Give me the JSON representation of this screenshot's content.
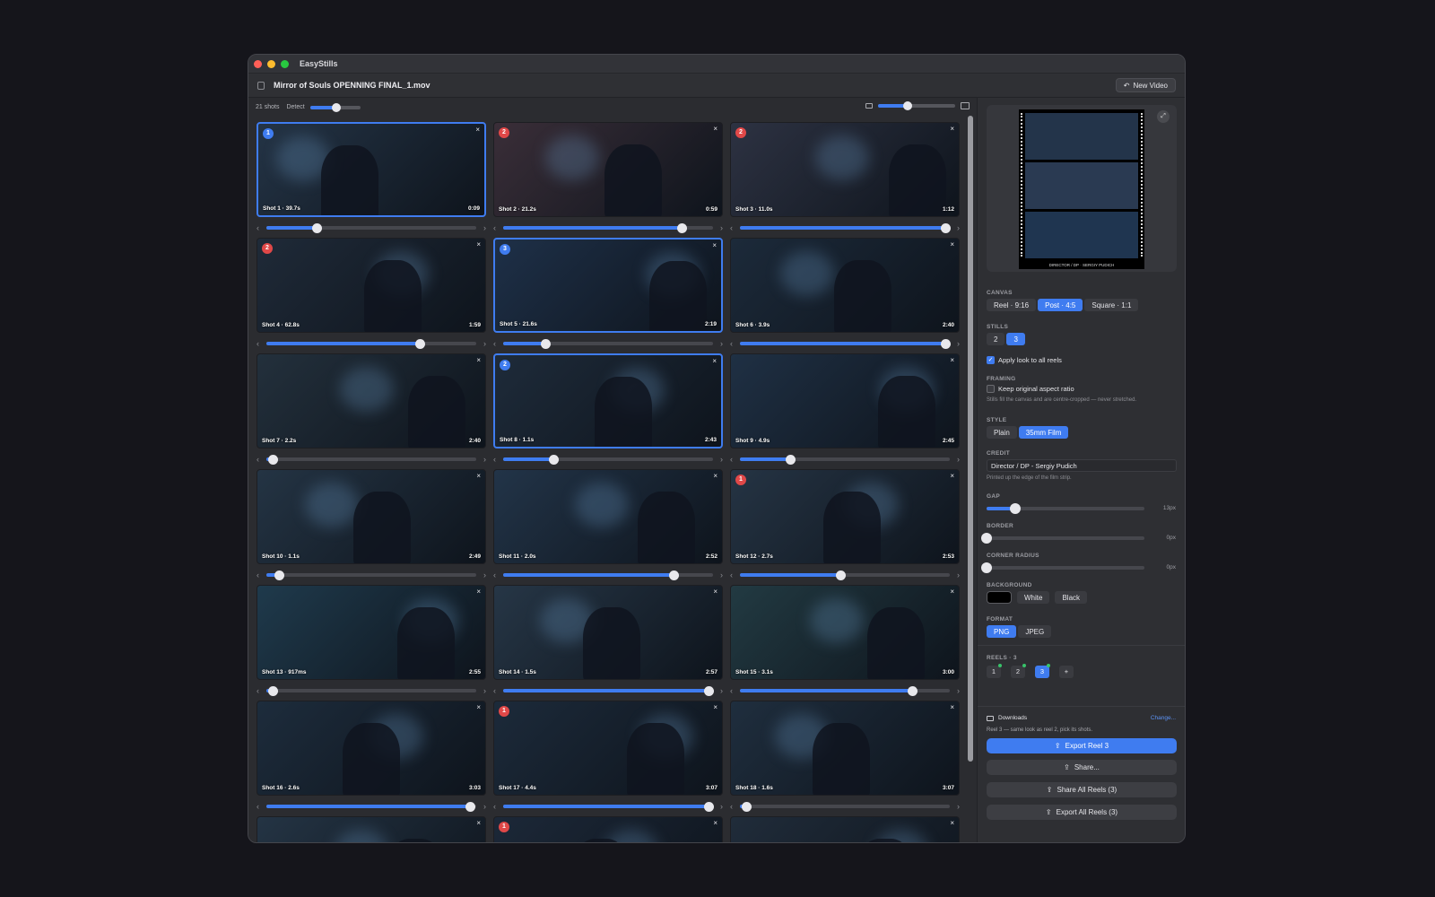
{
  "app": {
    "title": "EasyStills"
  },
  "file": {
    "name": "Mirror of Souls OPENNING FINAL_1.mov",
    "new_video_label": "New Video"
  },
  "toolbar": {
    "shots_count": "21 shots",
    "detect_label": "Detect",
    "detect_level": 0.52,
    "zoom_level": 0.38
  },
  "shots": [
    {
      "label": "Shot 1 · 39.7s",
      "time": "0:09",
      "badge": "1",
      "badge_color": "blue",
      "selected": true,
      "position": 0.24,
      "tone": "#243446"
    },
    {
      "label": "Shot 2 · 21.2s",
      "time": "0:59",
      "badge": "2",
      "badge_color": "red",
      "selected": false,
      "position": 0.85,
      "tone": "#3a2e38"
    },
    {
      "label": "Shot 3 · 11.0s",
      "time": "1:12",
      "badge": "2",
      "badge_color": "red",
      "selected": false,
      "position": 0.98,
      "tone": "#2d3242"
    },
    {
      "label": "Shot 4 · 62.8s",
      "time": "1:59",
      "badge": "2",
      "badge_color": "red",
      "selected": false,
      "position": 0.73,
      "tone": "#1f2a38"
    },
    {
      "label": "Shot 5 · 21.6s",
      "time": "2:19",
      "badge": "3",
      "badge_color": "blue",
      "selected": true,
      "position": 0.2,
      "tone": "#1e3048"
    },
    {
      "label": "Shot 6 · 3.9s",
      "time": "2:40",
      "badge": "",
      "badge_color": "",
      "selected": false,
      "position": 0.98,
      "tone": "#1c2a3a"
    },
    {
      "label": "Shot 7 · 2.2s",
      "time": "2:40",
      "badge": "",
      "badge_color": "",
      "selected": false,
      "position": 0.03,
      "tone": "#23303c"
    },
    {
      "label": "Shot 8 · 1.1s",
      "time": "2:43",
      "badge": "2",
      "badge_color": "blue",
      "selected": true,
      "position": 0.24,
      "tone": "#1e2b3a"
    },
    {
      "label": "Shot 9 · 4.9s",
      "time": "2:45",
      "badge": "",
      "badge_color": "",
      "selected": false,
      "position": 0.24,
      "tone": "#1f3044"
    },
    {
      "label": "Shot 10 · 1.1s",
      "time": "2:49",
      "badge": "",
      "badge_color": "",
      "selected": false,
      "position": 0.06,
      "tone": "#243444"
    },
    {
      "label": "Shot 11 · 2.0s",
      "time": "2:52",
      "badge": "",
      "badge_color": "",
      "selected": false,
      "position": 0.81,
      "tone": "#223448"
    },
    {
      "label": "Shot 12 · 2.7s",
      "time": "2:53",
      "badge": "1",
      "badge_color": "red",
      "selected": false,
      "position": 0.48,
      "tone": "#253444"
    },
    {
      "label": "Shot 13 · 917ms",
      "time": "2:55",
      "badge": "",
      "badge_color": "",
      "selected": false,
      "position": 0.03,
      "tone": "#1f3a4c"
    },
    {
      "label": "Shot 14 · 1.5s",
      "time": "2:57",
      "badge": "",
      "badge_color": "",
      "selected": false,
      "position": 0.98,
      "tone": "#263646"
    },
    {
      "label": "Shot 15 · 3.1s",
      "time": "3:00",
      "badge": "",
      "badge_color": "",
      "selected": false,
      "position": 0.82,
      "tone": "#223a42"
    },
    {
      "label": "Shot 16 · 2.6s",
      "time": "3:03",
      "badge": "",
      "badge_color": "",
      "selected": false,
      "position": 0.97,
      "tone": "#1d2c3c"
    },
    {
      "label": "Shot 17 · 4.4s",
      "time": "3:07",
      "badge": "1",
      "badge_color": "red",
      "selected": false,
      "position": 0.98,
      "tone": "#1c2a3a"
    },
    {
      "label": "Shot 18 · 1.6s",
      "time": "3:07",
      "badge": "",
      "badge_color": "",
      "selected": false,
      "position": 0.03,
      "tone": "#1f2e3e"
    },
    {
      "label": "",
      "time": "",
      "badge": "",
      "badge_color": "",
      "selected": false,
      "position": 0.5,
      "tone": "#243444"
    },
    {
      "label": "",
      "time": "",
      "badge": "1",
      "badge_color": "red",
      "selected": false,
      "position": 0.5,
      "tone": "#1c2838"
    },
    {
      "label": "",
      "time": "",
      "badge": "",
      "badge_color": "",
      "selected": false,
      "position": 0.5,
      "tone": "#202c3a"
    }
  ],
  "panel": {
    "preview_credit": "DIRECTOR / DP · SERGIY PUDICH",
    "canvas": {
      "label": "CANVAS",
      "options": [
        "Reel · 9:16",
        "Post · 4:5",
        "Square · 1:1"
      ],
      "selected": 1
    },
    "stills": {
      "label": "STILLS",
      "options": [
        "2",
        "3"
      ],
      "selected": 1
    },
    "apply_look": {
      "label": "Apply look to all reels",
      "checked": true
    },
    "framing": {
      "label": "FRAMING",
      "keep_aspect": "Keep original aspect ratio",
      "checked": false,
      "hint": "Stills fill the canvas and are centre-cropped — never stretched."
    },
    "style": {
      "label": "STYLE",
      "options": [
        "Plain",
        "35mm Film"
      ],
      "selected": 1
    },
    "credit": {
      "label": "CREDIT",
      "value": "Director / DP - Sergiy Pudich",
      "hint": "Printed up the edge of the film strip."
    },
    "gap": {
      "label": "GAP",
      "value": "13px",
      "level": 0.18
    },
    "border": {
      "label": "BORDER",
      "value": "0px",
      "level": 0
    },
    "corner_radius": {
      "label": "CORNER RADIUS",
      "value": "0px",
      "level": 0
    },
    "background": {
      "label": "BACKGROUND",
      "swatch_color": "#000000",
      "options": [
        "White",
        "Black"
      ]
    },
    "format": {
      "label": "FORMAT",
      "options": [
        "PNG",
        "JPEG"
      ],
      "selected": 0
    },
    "reels": {
      "label": "REELS · 3",
      "items": [
        "1",
        "2",
        "3"
      ],
      "selected": 2,
      "add_label": "+"
    },
    "downloads": {
      "label": "Downloads",
      "change_label": "Change...",
      "note": "Reel 3 — same look as reel 2, pick its shots."
    },
    "actions": {
      "export_reel": "Export Reel 3",
      "share": "Share...",
      "share_all": "Share All Reels (3)",
      "export_all": "Export All Reels (3)"
    }
  },
  "colors": {
    "accent": "#3f7cf0",
    "badge_red": "#e04848",
    "window_bg": "#2b2c30"
  }
}
